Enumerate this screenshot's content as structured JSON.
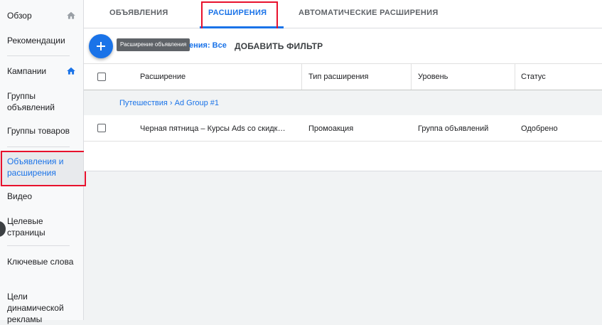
{
  "sidebar": {
    "items": [
      {
        "label": "Обзор"
      },
      {
        "label": "Рекомендации"
      },
      {
        "label": "Кампании"
      },
      {
        "label": "Группы объявлений"
      },
      {
        "label": "Группы товаров"
      },
      {
        "label": "Объявления и расширения",
        "active": true
      },
      {
        "label": "Видео"
      },
      {
        "label": "Целевые страницы"
      },
      {
        "label": "Ключевые слова"
      },
      {
        "label": "Цели динамической рекламы"
      }
    ]
  },
  "tabs": [
    {
      "label": "ОБЪЯВЛЕНИЯ"
    },
    {
      "label": "РАСШИРЕНИЯ",
      "active": true
    },
    {
      "label": "АВТОМАТИЧЕСКИЕ РАСШИРЕНИЯ"
    }
  ],
  "toolbar": {
    "fab_tooltip": "Расширение объявления",
    "filter_partial": "ения: Все",
    "add_filter_label": "ДОБАВИТЬ ФИЛЬТР"
  },
  "table": {
    "columns": [
      "Расширение",
      "Тип расширения",
      "Уровень",
      "Статус"
    ],
    "group_label": "Путешествия › Ad Group #1",
    "rows": [
      {
        "extension": "Черная пятница – Курсы Ads со скидко…",
        "type": "Промоакция",
        "level": "Группа объявлений",
        "status": "Одобрено"
      }
    ]
  },
  "colors": {
    "accent": "#1a73e8",
    "highlight_box": "#e8112d"
  },
  "icons": [
    "home-icon",
    "add-icon",
    "checkbox-icon"
  ]
}
